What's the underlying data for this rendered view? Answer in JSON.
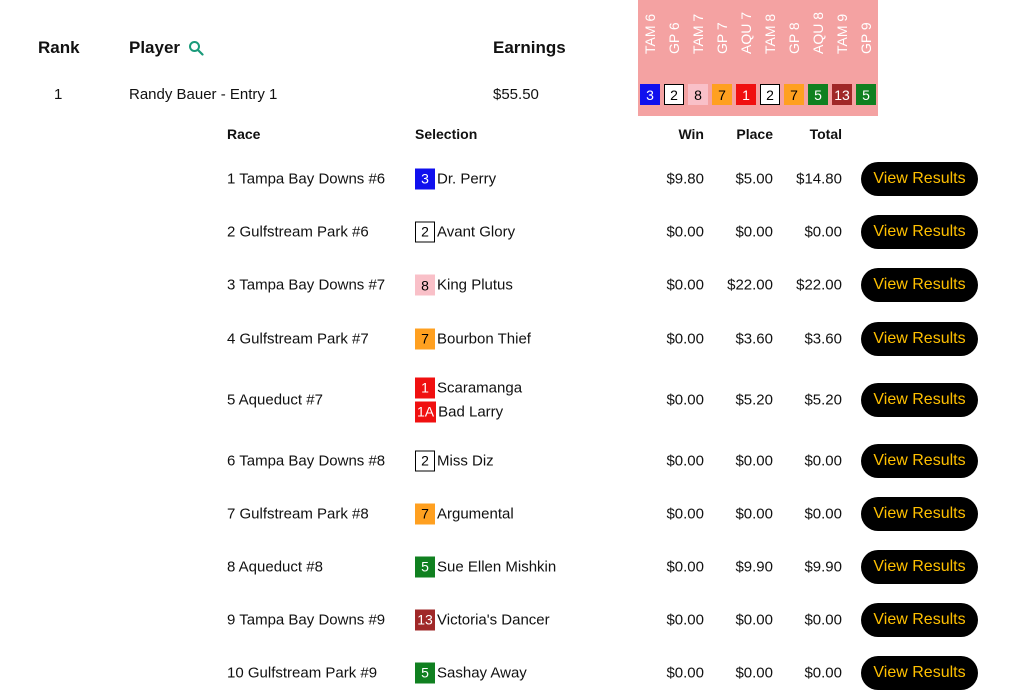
{
  "header": {
    "rank": "Rank",
    "player": "Player",
    "earnings": "Earnings"
  },
  "race_columns": [
    "TAM 6",
    "GP 6",
    "TAM 7",
    "GP 7",
    "AQU 7",
    "TAM 8",
    "GP 8",
    "AQU 8",
    "TAM 9",
    "GP 9"
  ],
  "entry": {
    "rank": "1",
    "player": "Randy Bauer - Entry 1",
    "earnings": "$55.50",
    "picks": [
      {
        "num": "3",
        "bg": "#1010ee",
        "fg": "#ffffff",
        "border": "none"
      },
      {
        "num": "2",
        "bg": "#ffffff",
        "fg": "#000000",
        "border": "1px solid #000"
      },
      {
        "num": "8",
        "bg": "#f9c0c8",
        "fg": "#000000",
        "border": "none"
      },
      {
        "num": "7",
        "bg": "#ffa020",
        "fg": "#000000",
        "border": "none"
      },
      {
        "num": "1",
        "bg": "#f01010",
        "fg": "#ffffff",
        "border": "none"
      },
      {
        "num": "2",
        "bg": "#ffffff",
        "fg": "#000000",
        "border": "1px solid #000"
      },
      {
        "num": "7",
        "bg": "#ffa020",
        "fg": "#000000",
        "border": "none"
      },
      {
        "num": "5",
        "bg": "#108020",
        "fg": "#ffffff",
        "border": "none"
      },
      {
        "num": "13",
        "bg": "#a02828",
        "fg": "#ffffff",
        "border": "none"
      },
      {
        "num": "5",
        "bg": "#108020",
        "fg": "#ffffff",
        "border": "none"
      }
    ]
  },
  "detail_header": {
    "race": "Race",
    "selection": "Selection",
    "win": "Win",
    "place": "Place",
    "total": "Total"
  },
  "button_label": "View Results",
  "rows": [
    {
      "race": "1 Tampa Bay Downs #6",
      "sel": [
        {
          "num": "3",
          "bg": "#1010ee",
          "fg": "#ffffff",
          "border": "none",
          "name": "Dr. Perry"
        }
      ],
      "win": "$9.80",
      "place": "$5.00",
      "total": "$14.80"
    },
    {
      "race": "2 Gulfstream Park #6",
      "sel": [
        {
          "num": "2",
          "bg": "#ffffff",
          "fg": "#000000",
          "border": "1px solid #000",
          "name": "Avant Glory"
        }
      ],
      "win": "$0.00",
      "place": "$0.00",
      "total": "$0.00"
    },
    {
      "race": "3 Tampa Bay Downs #7",
      "sel": [
        {
          "num": "8",
          "bg": "#f9c0c8",
          "fg": "#000000",
          "border": "none",
          "name": "King Plutus"
        }
      ],
      "win": "$0.00",
      "place": "$22.00",
      "total": "$22.00"
    },
    {
      "race": "4 Gulfstream Park #7",
      "sel": [
        {
          "num": "7",
          "bg": "#ffa020",
          "fg": "#000000",
          "border": "none",
          "name": "Bourbon Thief"
        }
      ],
      "win": "$0.00",
      "place": "$3.60",
      "total": "$3.60"
    },
    {
      "race": "5 Aqueduct #7",
      "sel": [
        {
          "num": "1",
          "bg": "#f01010",
          "fg": "#ffffff",
          "border": "none",
          "name": "Scaramanga"
        },
        {
          "num": "1A",
          "bg": "#f01010",
          "fg": "#ffffff",
          "border": "none",
          "name": "Bad Larry"
        }
      ],
      "win": "$0.00",
      "place": "$5.20",
      "total": "$5.20"
    },
    {
      "race": "6 Tampa Bay Downs #8",
      "sel": [
        {
          "num": "2",
          "bg": "#ffffff",
          "fg": "#000000",
          "border": "1px solid #000",
          "name": "Miss Diz"
        }
      ],
      "win": "$0.00",
      "place": "$0.00",
      "total": "$0.00"
    },
    {
      "race": "7 Gulfstream Park #8",
      "sel": [
        {
          "num": "7",
          "bg": "#ffa020",
          "fg": "#000000",
          "border": "none",
          "name": "Argumental"
        }
      ],
      "win": "$0.00",
      "place": "$0.00",
      "total": "$0.00"
    },
    {
      "race": "8 Aqueduct #8",
      "sel": [
        {
          "num": "5",
          "bg": "#108020",
          "fg": "#ffffff",
          "border": "none",
          "name": "Sue Ellen Mishkin"
        }
      ],
      "win": "$0.00",
      "place": "$9.90",
      "total": "$9.90"
    },
    {
      "race": "9 Tampa Bay Downs #9",
      "sel": [
        {
          "num": "13",
          "bg": "#a02828",
          "fg": "#ffffff",
          "border": "none",
          "name": "Victoria's Dancer"
        }
      ],
      "win": "$0.00",
      "place": "$0.00",
      "total": "$0.00"
    },
    {
      "race": "10 Gulfstream Park #9",
      "sel": [
        {
          "num": "5",
          "bg": "#108020",
          "fg": "#ffffff",
          "border": "none",
          "name": "Sashay Away"
        }
      ],
      "win": "$0.00",
      "place": "$0.00",
      "total": "$0.00"
    }
  ],
  "colors": {
    "accent_button_text": "#ffc000",
    "panel_pink": "#f4a2a2",
    "search_icon": "#1a9a7a"
  }
}
